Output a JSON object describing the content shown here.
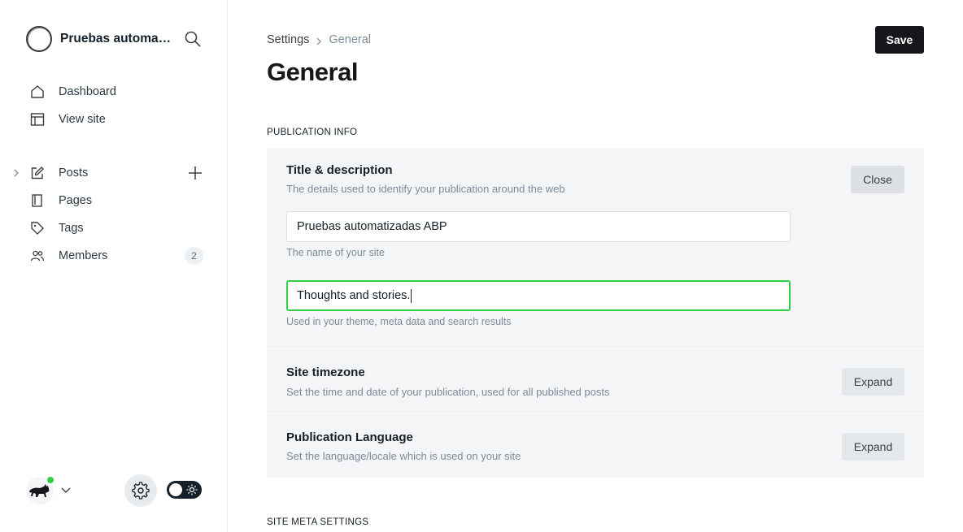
{
  "sidebar": {
    "site_name": "Pruebas automatizadas ABP",
    "top_items": [
      {
        "label": "Dashboard",
        "icon": "home-icon"
      },
      {
        "label": "View site",
        "icon": "layout-icon"
      }
    ],
    "main_items": [
      {
        "label": "Posts",
        "icon": "pencil-icon"
      },
      {
        "label": "Pages",
        "icon": "page-icon"
      },
      {
        "label": "Tags",
        "icon": "tag-icon"
      },
      {
        "label": "Members",
        "icon": "members-icon",
        "count": "2"
      }
    ]
  },
  "header": {
    "breadcrumb_parent": "Settings",
    "breadcrumb_current": "General",
    "title": "General",
    "save_label": "Save"
  },
  "sections": {
    "publication_info": "PUBLICATION INFO",
    "site_meta": "SITE META SETTINGS"
  },
  "title_description": {
    "title": "Title & description",
    "description": "The details used to identify your publication around the web",
    "close_label": "Close",
    "site_title_value": "Pruebas automatizadas ABP",
    "site_title_hint": "The name of your site",
    "site_description_value": "Thoughts and stories.",
    "site_description_hint": "Used in your theme, meta data and search results"
  },
  "timezone": {
    "title": "Site timezone",
    "description": "Set the time and date of your publication, used for all published posts",
    "expand_label": "Expand"
  },
  "language": {
    "title": "Publication Language",
    "description": "Set the language/locale which is used on your site",
    "expand_label": "Expand"
  },
  "colors": {
    "accent_green": "#30cf43",
    "dark": "#15171a",
    "panel_bg": "#f4f5f6"
  }
}
